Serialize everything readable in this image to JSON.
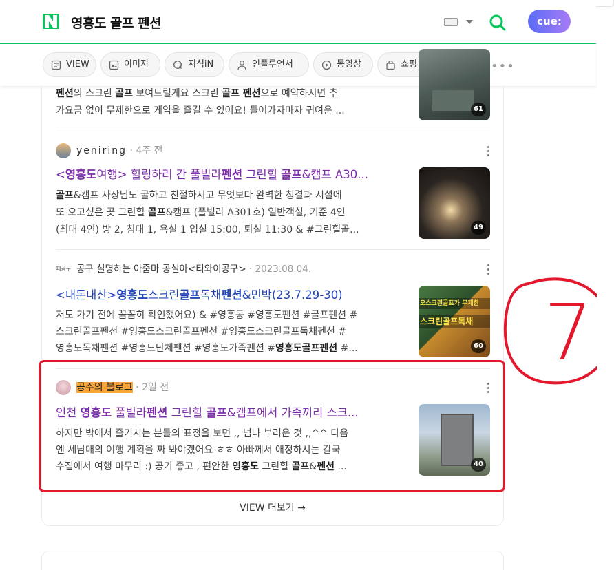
{
  "search": {
    "query": "영흥도 골프 펜션",
    "cue_label": "cue:"
  },
  "tabs": [
    {
      "label": "VIEW",
      "icon": "document-icon"
    },
    {
      "label": "이미지",
      "icon": "image-icon"
    },
    {
      "label": "지식iN",
      "icon": "q-icon"
    },
    {
      "label": "인플루언서",
      "icon": "person-icon"
    },
    {
      "label": "동영상",
      "icon": "play-icon"
    },
    {
      "label": "쇼핑",
      "icon": "bag-icon"
    }
  ],
  "tabs_more": "•••",
  "results": [
    {
      "lines": [
        "<b>펜션</b>의 스크린 <b>골프</b> 보여드릴게요 스크린 <b>골프 펜션</b>으로 예약하시면 추",
        "가요금 없이 무제한으로 게임을 즐길 수 있어요! 들어가자마자 귀여운 ..."
      ],
      "photo_count": "61"
    },
    {
      "author": "yeniring",
      "date": "4주 전",
      "title": "<<b>영흥도</b>여행> 힐링하러 간 풀빌라<b>펜션</b> 그린힐 <b>골프</b>&캠프 A30...",
      "lines": [
        "<b>골프</b>&캠프 사장님도 굴하고 친절하시고 무엇보다 완벽한 청결과 시설에",
        "또 오고싶은 곳 그린힐 <b>골프</b>&캠프 (풀빌라 A301호) 일반객실, 기준 4인",
        "(최대 4인) 방 2, 침대 1, 욕실 1 입실 15:00, 퇴실 11:30 & #그린힐골..."
      ],
      "photo_count": "49"
    },
    {
      "author_logo": "떼공구",
      "author": "공구 설명하는 아줌마 공설아<티와이공구>",
      "date": "2023.08.04.",
      "title": "<내돈내산><b>영흥도</b>스크린<b>골프</b>독채<b>펜션</b>&민박(23.7.29-30)",
      "lines": [
        "저도 가기 전에 꼼꼼히 확인했어요) & #영흥동 #영흥도펜션 #골프펜션 #",
        "스크린골프펜션 #영흥도스크린골프펜션 #영흥도스크린골프독채펜션 #",
        "영흥도독채펜션 #영흥도단체펜션 #영흥도가족펜션 #<b>영흥도골프펜션</b> #..."
      ],
      "thumb_text": "오스크린골프가 무제한",
      "thumb_text2": "스크린골프독채",
      "photo_count": "60"
    },
    {
      "author": "공주의 블로그",
      "date": "2일 전",
      "title": "인천 <b>영흥도</b> 풀빌라<b>펜션</b> 그린힐 <b>골프</b>&캠프에서 가족끼리 스크...",
      "lines": [
        "하지만 밖에서 즐기시는 분들의 표정을 보면 ,, 넘나 부러운 것 ,,^^ 다음",
        "엔 세남매의 여행 계획을 짜 봐야겠어요 ㅎㅎ 아빠께서 애정하시는 칼국",
        "수집에서 여행 마무리 :) 공기 좋고 , 편안한 <b>영흥도</b> 그린힐 <b>골프</b>&<b>펜션</b> ..."
      ],
      "photo_count": "40"
    }
  ],
  "view_more": "VIEW 더보기 →",
  "annotation": "7",
  "colors": {
    "naver_green": "#03c75a",
    "title_purple": "#7b2ca8",
    "title_blue": "#2145b8",
    "highlight_red": "#e3182d",
    "author_highlight": "#f7a53b"
  }
}
